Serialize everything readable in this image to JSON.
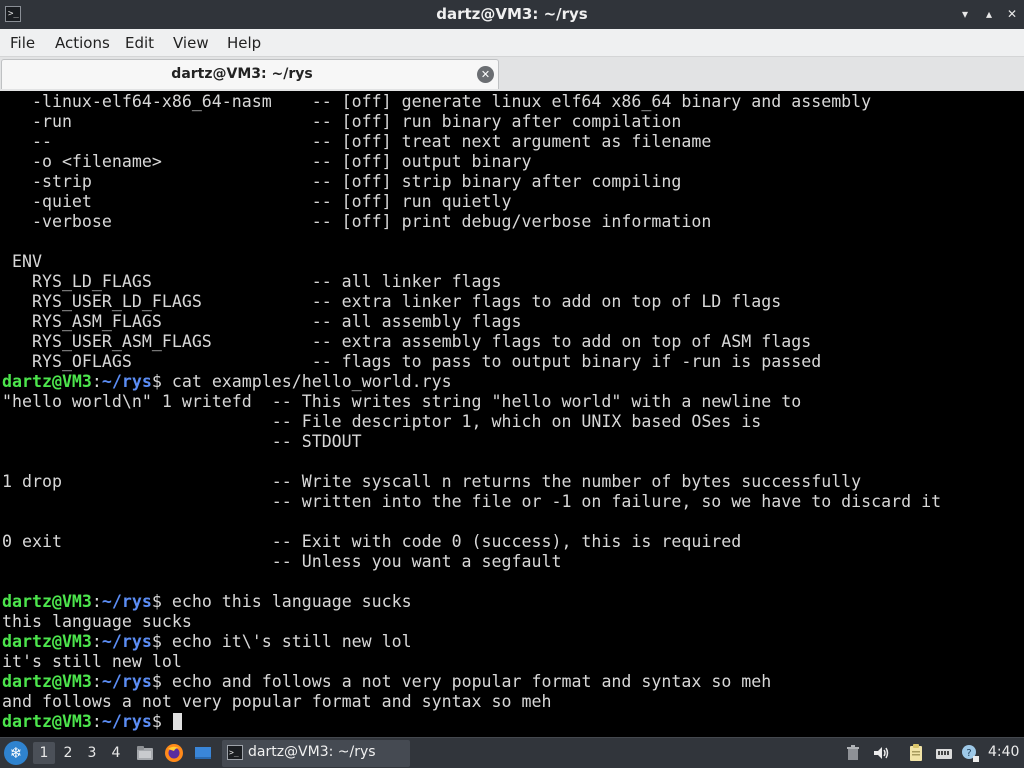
{
  "window": {
    "title": "dartz@VM3: ~/rys",
    "app_icon": "terminal-icon",
    "controls": [
      "minimize-icon",
      "maximize-icon",
      "close-icon"
    ]
  },
  "menubar": {
    "items": [
      "File",
      "Actions",
      "Edit",
      "View",
      "Help"
    ]
  },
  "tabs": [
    {
      "label": "dartz@VM3: ~/rys",
      "active": true
    }
  ],
  "prompt": {
    "user_host": "dartz@VM3",
    "colon": ":",
    "path": "~/rys",
    "symbol": "$ "
  },
  "terminal": {
    "lines": [
      {
        "type": "text",
        "text": "   -linux-elf64-x86_64-nasm    -- [off] generate linux elf64 x86_64 binary and assembly"
      },
      {
        "type": "text",
        "text": "   -run                        -- [off] run binary after compilation"
      },
      {
        "type": "text",
        "text": "   --                          -- [off] treat next argument as filename"
      },
      {
        "type": "text",
        "text": "   -o <filename>               -- [off] output binary"
      },
      {
        "type": "text",
        "text": "   -strip                      -- [off] strip binary after compiling"
      },
      {
        "type": "text",
        "text": "   -quiet                      -- [off] run quietly"
      },
      {
        "type": "text",
        "text": "   -verbose                    -- [off] print debug/verbose information"
      },
      {
        "type": "text",
        "text": ""
      },
      {
        "type": "text",
        "text": " ENV"
      },
      {
        "type": "text",
        "text": "   RYS_LD_FLAGS                -- all linker flags"
      },
      {
        "type": "text",
        "text": "   RYS_USER_LD_FLAGS           -- extra linker flags to add on top of LD flags"
      },
      {
        "type": "text",
        "text": "   RYS_ASM_FLAGS               -- all assembly flags"
      },
      {
        "type": "text",
        "text": "   RYS_USER_ASM_FLAGS          -- extra assembly flags to add on top of ASM flags"
      },
      {
        "type": "text",
        "text": "   RYS_OFLAGS                  -- flags to pass to output binary if -run is passed"
      },
      {
        "type": "prompt",
        "command": "cat examples/hello_world.rys"
      },
      {
        "type": "text",
        "text": "\"hello world\\n\" 1 writefd  -- This writes string \"hello world\" with a newline to"
      },
      {
        "type": "text",
        "text": "                           -- File descriptor 1, which on UNIX based OSes is"
      },
      {
        "type": "text",
        "text": "                           -- STDOUT"
      },
      {
        "type": "text",
        "text": ""
      },
      {
        "type": "text",
        "text": "1 drop                     -- Write syscall n returns the number of bytes successfully"
      },
      {
        "type": "text",
        "text": "                           -- written into the file or -1 on failure, so we have to discard it"
      },
      {
        "type": "text",
        "text": ""
      },
      {
        "type": "text",
        "text": "0 exit                     -- Exit with code 0 (success), this is required"
      },
      {
        "type": "text",
        "text": "                           -- Unless you want a segfault"
      },
      {
        "type": "text",
        "text": ""
      },
      {
        "type": "prompt",
        "command": "echo this language sucks"
      },
      {
        "type": "text",
        "text": "this language sucks"
      },
      {
        "type": "prompt",
        "command": "echo it\\'s still new lol"
      },
      {
        "type": "text",
        "text": "it's still new lol"
      },
      {
        "type": "prompt",
        "command": "echo and follows a not very popular format and syntax so meh"
      },
      {
        "type": "text",
        "text": "and follows a not very popular format and syntax so meh"
      },
      {
        "type": "prompt",
        "command": "",
        "cursor": true
      }
    ]
  },
  "taskbar": {
    "start_icon": "start-menu-icon",
    "workspaces": [
      "1",
      "2",
      "3",
      "4"
    ],
    "active_workspace": "1",
    "launchers": [
      "file-manager-icon",
      "firefox-icon",
      "show-desktop-icon"
    ],
    "task": {
      "label": "dartz@VM3: ~/rys",
      "icon": "terminal-icon"
    },
    "tray": [
      "trash-icon",
      "volume-icon",
      "clipboard-icon",
      "network-icon",
      "update-notifier-icon"
    ],
    "clock": "4:40",
    "colors": {
      "prompt_user": "#4ce64c",
      "prompt_path": "#5b8df5",
      "terminal_bg": "#000000"
    }
  }
}
